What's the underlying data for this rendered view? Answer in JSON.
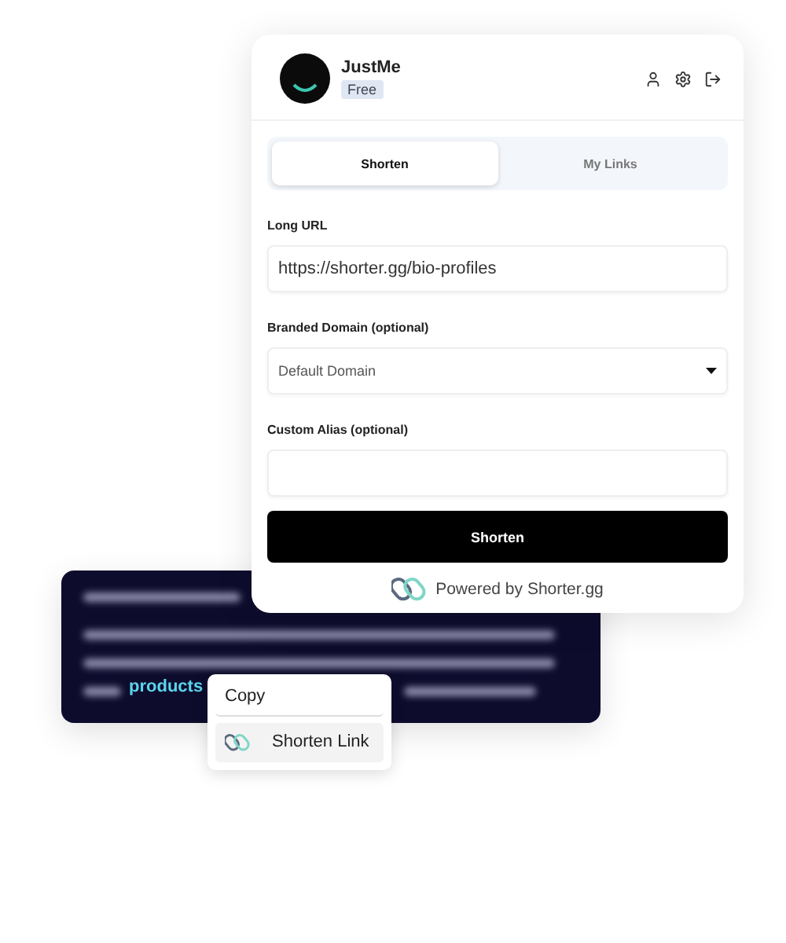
{
  "user": {
    "name": "JustMe",
    "plan": "Free"
  },
  "tabs": [
    {
      "label": "Shorten",
      "selected": true
    },
    {
      "label": "My Links",
      "selected": false
    }
  ],
  "form": {
    "long_url": {
      "label": "Long URL",
      "value": "https://shorter.gg/bio-profiles"
    },
    "domain": {
      "label": "Branded Domain (optional)",
      "value": "Default Domain"
    },
    "alias": {
      "label": "Custom Alias (optional)"
    },
    "submit": "Shorten"
  },
  "footer": "Powered by Shorter.gg",
  "article": {
    "highlight": "products"
  },
  "context_menu": [
    {
      "label": "Copy",
      "kind": "plain"
    },
    {
      "label": "Shorten Link",
      "kind": "icon"
    }
  ]
}
